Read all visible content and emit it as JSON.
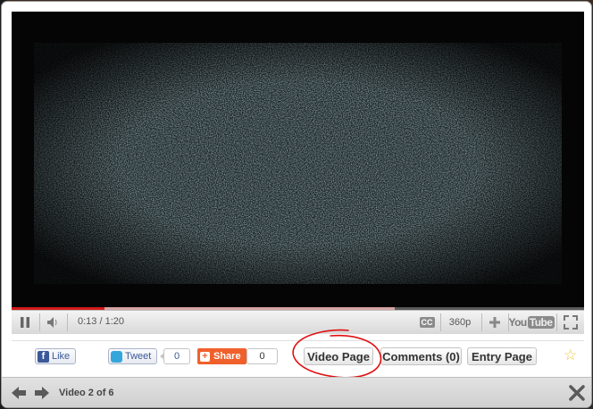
{
  "player": {
    "time_display": "0:13 / 1:20",
    "progress_fraction": 0.1625,
    "buffered_fraction": 0.67,
    "quality": "360p",
    "cc_label": "CC",
    "logo_you": "You",
    "logo_tube": "Tube"
  },
  "share_bar": {
    "like_label": "Like",
    "tweet_label": "Tweet",
    "tweet_count": "0",
    "share_label": "Share",
    "share_count": "0",
    "video_page_label": "Video Page",
    "comments_label": "Comments (0)",
    "entry_page_label": "Entry Page"
  },
  "footer": {
    "video_counter": "Video 2 of 6"
  },
  "colors": {
    "progress_played": "#d21c1c",
    "share_orange": "#f0602c",
    "annotation_red": "#e01010",
    "star": "#f3c43a"
  },
  "icons": [
    "pause-icon",
    "volume-icon",
    "cc-icon",
    "plus-icon",
    "fullscreen-icon",
    "facebook-icon",
    "twitter-icon",
    "star-icon",
    "prev-arrow-icon",
    "next-arrow-icon",
    "close-icon"
  ]
}
